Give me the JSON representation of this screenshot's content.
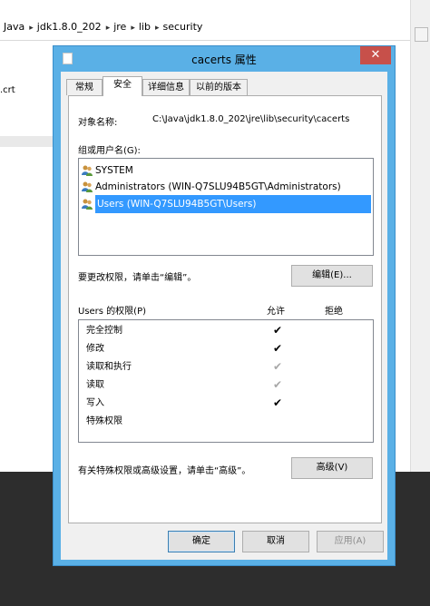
{
  "explorer": {
    "breadcrumbs": [
      "Java",
      "jdk1.8.0_202",
      "jre",
      "lib",
      "security"
    ],
    "file_fragment": ".crt"
  },
  "dialog": {
    "title": "cacerts 属性",
    "close_glyph": "✕",
    "tabs": [
      {
        "label": "常规",
        "active": false
      },
      {
        "label": "安全",
        "active": true
      },
      {
        "label": "详细信息",
        "active": false
      },
      {
        "label": "以前的版本",
        "active": false
      }
    ],
    "object_name_label": "对象名称:",
    "object_name_value": "C:\\Java\\jdk1.8.0_202\\jre\\lib\\security\\cacerts",
    "groups_label": "组或用户名(G):",
    "groups": [
      {
        "name": "SYSTEM",
        "icon": "users-icon",
        "selected": false
      },
      {
        "name": "Administrators (WIN-Q7SLU94B5GT\\Administrators)",
        "icon": "users-icon",
        "selected": false
      },
      {
        "name": "Users (WIN-Q7SLU94B5GT\\Users)",
        "icon": "users-icon",
        "selected": true
      }
    ],
    "change_hint": "要更改权限，请单击“编辑”。",
    "edit_button": "编辑(E)...",
    "permissions_label": "Users 的权限(P)",
    "allow_header": "允许",
    "deny_header": "拒绝",
    "permissions": [
      {
        "name": "完全控制",
        "allow": true,
        "inherited": false
      },
      {
        "name": "修改",
        "allow": true,
        "inherited": false
      },
      {
        "name": "读取和执行",
        "allow": true,
        "inherited": true
      },
      {
        "name": "读取",
        "allow": true,
        "inherited": true
      },
      {
        "name": "写入",
        "allow": true,
        "inherited": false
      },
      {
        "name": "特殊权限",
        "allow": false,
        "inherited": false
      }
    ],
    "check_glyph": "✔",
    "advanced_hint": "有关特殊权限或高级设置，请单击“高级”。",
    "advanced_button": "高级(V)",
    "ok_button": "确定",
    "cancel_button": "取消",
    "apply_button": "应用(A)"
  }
}
